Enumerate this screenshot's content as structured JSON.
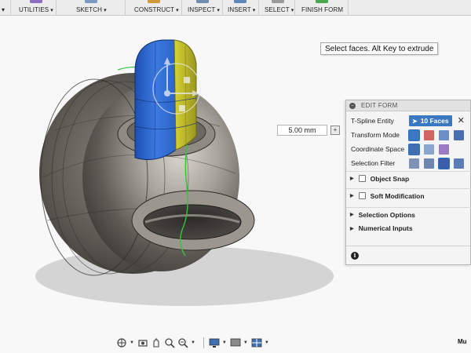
{
  "toolbar": {
    "items": [
      {
        "label": "UTILITIES"
      },
      {
        "label": "SKETCH"
      },
      {
        "label": "CONSTRUCT"
      },
      {
        "label": "INSPECT"
      },
      {
        "label": "INSERT"
      },
      {
        "label": "SELECT"
      },
      {
        "label": "FINISH FORM"
      }
    ],
    "caret": "▾",
    "icons": [
      "utilities-icon",
      "sketch-icon",
      "construct-icon",
      "inspect-icon",
      "insert-icon",
      "select-icon",
      "finish-form-icon"
    ]
  },
  "viewport": {
    "tooltip": "Select faces. Alt Key to extrude",
    "distance_value": "5.00 mm",
    "colors": {
      "body": "#6f6c66",
      "selected_face_blue": "#2a64c8",
      "selected_face_yellow": "#c8c42a",
      "seam_green": "#37c23a",
      "shadow": "#cfcfcf"
    }
  },
  "panel": {
    "title": "EDIT FORM",
    "collapse_glyph": "–",
    "rows": {
      "tspline_entity": {
        "label": "T-Spline Entity",
        "value": "10 Faces"
      },
      "transform_mode": {
        "label": "Transform Mode"
      },
      "coordinate_space": {
        "label": "Coordinate Space"
      },
      "selection_filter": {
        "label": "Selection Filter"
      }
    },
    "close_glyph": "✕",
    "sections": [
      {
        "label": "Object Snap"
      },
      {
        "label": "Soft Modification"
      },
      {
        "label": "Selection Options"
      },
      {
        "label": "Numerical Inputs"
      }
    ],
    "info_glyph": "i",
    "accent": "#3a78c2"
  },
  "corner": {
    "text": "Mu"
  }
}
